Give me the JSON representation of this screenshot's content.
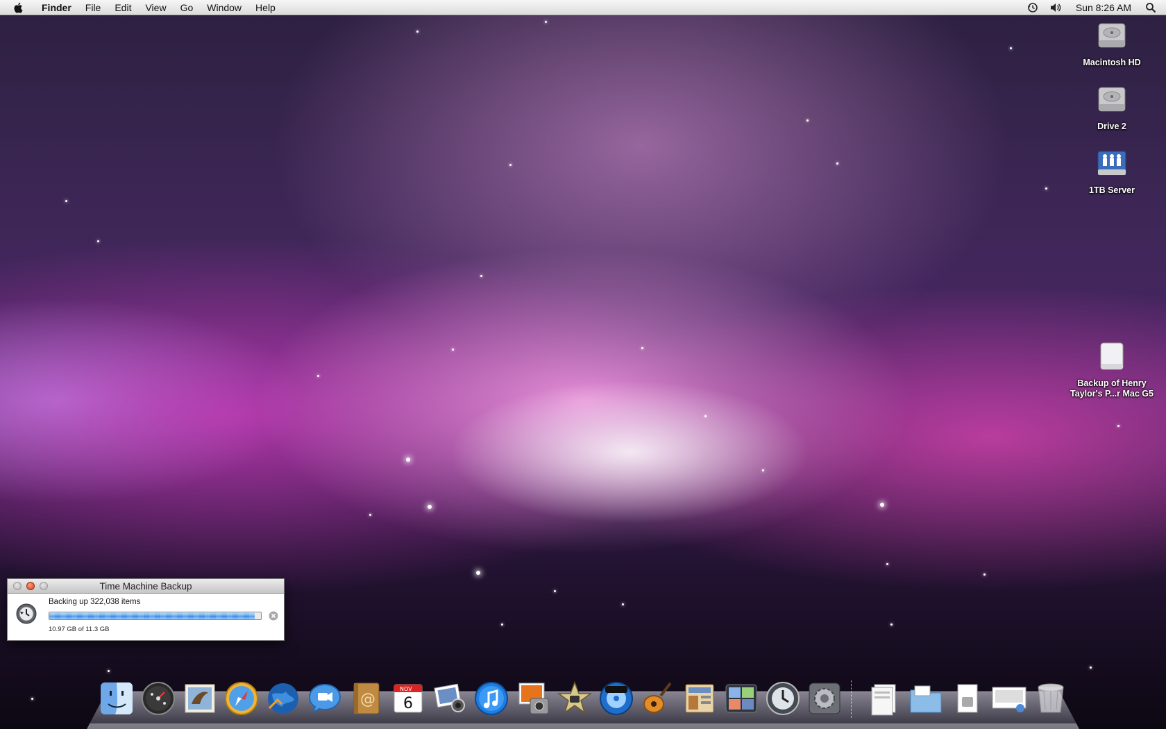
{
  "menubar": {
    "app_name": "Finder",
    "items": [
      "File",
      "Edit",
      "View",
      "Go",
      "Window",
      "Help"
    ],
    "clock": "Sun 8:26 AM"
  },
  "desktop_icons": [
    {
      "label_line1": "Macintosh HD",
      "label_line2": "",
      "icon": "hard-drive-icon"
    },
    {
      "label_line1": "Drive 2",
      "label_line2": "",
      "icon": "hard-drive-icon"
    },
    {
      "label_line1": "1TB Server",
      "label_line2": "",
      "icon": "network-server-icon"
    },
    {
      "label_line1": "Backup of Henry",
      "label_line2": "Taylor's P...r Mac G5",
      "icon": "external-drive-icon"
    }
  ],
  "time_machine_window": {
    "title": "Time Machine Backup",
    "status": "Backing up 322,038 items",
    "progress_fraction": 0.97,
    "size_text": "10.97 GB of 11.3 GB"
  },
  "dock": {
    "apps": [
      "finder-icon",
      "dashboard-icon",
      "mail-icon",
      "safari-icon",
      "network-globe-icon",
      "ichat-icon",
      "address-book-icon",
      "ical-icon",
      "iphoto-icon",
      "itunes-icon",
      "photo-booth-icon",
      "imovie-icon",
      "idvd-icon",
      "garageband-icon",
      "iweb-icon",
      "spaces-icon",
      "time-machine-icon",
      "system-preferences-icon"
    ],
    "stacks": [
      "documents-stack-icon",
      "folder-stack-icon",
      "downloads-stack-icon",
      "screenshot-stack-icon",
      "trash-icon"
    ],
    "ical_month": "NOV",
    "ical_day": "6"
  },
  "colors": {
    "menubar": "#e8e8e8",
    "progress": "#4a90e2",
    "aurora_pink": "#e060c0"
  }
}
